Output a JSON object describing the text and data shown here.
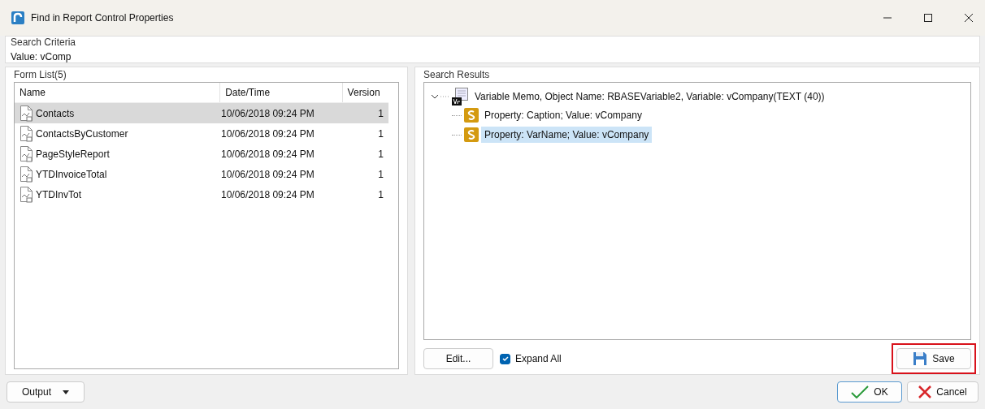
{
  "window": {
    "title": "Find in Report Control Properties"
  },
  "search_criteria": {
    "legend": "Search Criteria",
    "value": "Value: vComp"
  },
  "form_list": {
    "legend": "Form List(5)",
    "columns": [
      "Name",
      "Date/Time",
      "Version"
    ],
    "rows": [
      {
        "name": "Contacts",
        "datetime": "10/06/2018 09:24 PM",
        "version": "1",
        "selected": true
      },
      {
        "name": "ContactsByCustomer",
        "datetime": "10/06/2018 09:24 PM",
        "version": "1",
        "selected": false
      },
      {
        "name": "PageStyleReport",
        "datetime": "10/06/2018 09:24 PM",
        "version": "1",
        "selected": false
      },
      {
        "name": "YTDInvoiceTotal",
        "datetime": "10/06/2018 09:24 PM",
        "version": "1",
        "selected": false
      },
      {
        "name": "YTDInvTot",
        "datetime": "10/06/2018 09:24 PM",
        "version": "1",
        "selected": false
      }
    ]
  },
  "search_results": {
    "legend": "Search Results",
    "tree": [
      {
        "label": "Variable Memo, Object Name: RBASEVariable2, Variable: vCompany(TEXT (40))",
        "expanded": true,
        "selected": false,
        "children": [
          {
            "label": "Property: Caption; Value: vCompany",
            "selected": false
          },
          {
            "label": "Property: VarName; Value: vCompany",
            "selected": true
          }
        ]
      }
    ]
  },
  "edit_button": "Edit...",
  "expand_all": {
    "label": "Expand All",
    "checked": true
  },
  "save_button": {
    "label": "Save",
    "highlighted": true
  },
  "output_button": "Output",
  "ok_button": "OK",
  "cancel_button": "Cancel"
}
